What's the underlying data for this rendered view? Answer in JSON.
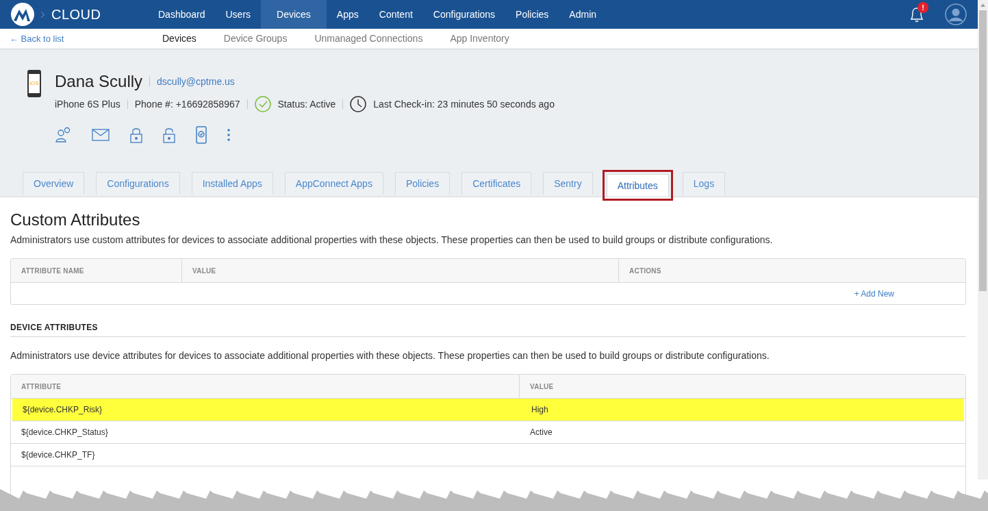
{
  "top_nav": {
    "brand": "CLOUD",
    "items": [
      {
        "label": "Dashboard",
        "selected": false
      },
      {
        "label": "Users",
        "selected": false
      },
      {
        "label": "Devices",
        "selected": true
      },
      {
        "label": "Apps",
        "selected": false
      },
      {
        "label": "Content",
        "selected": false
      },
      {
        "label": "Configurations",
        "selected": false
      },
      {
        "label": "Policies",
        "selected": false
      },
      {
        "label": "Admin",
        "selected": false
      }
    ],
    "notification_badge": "!"
  },
  "sub_nav": {
    "back_link": "← Back to list",
    "items": [
      {
        "label": "Devices",
        "selected": true
      },
      {
        "label": "Device Groups",
        "selected": false
      },
      {
        "label": "Unmanaged Connections",
        "selected": false
      },
      {
        "label": "App Inventory",
        "selected": false
      }
    ]
  },
  "device": {
    "platform_label": "iOS",
    "name": "Dana Scully",
    "email": "dscully@cptme.us",
    "model": "iPhone 6S Plus",
    "phone": "Phone #: +16692858967",
    "status": "Status: Active",
    "last_checkin": "Last Check-in: 23 minutes 50 seconds ago"
  },
  "tabs": [
    {
      "label": "Overview",
      "selected": false,
      "highlighted": false
    },
    {
      "label": "Configurations",
      "selected": false,
      "highlighted": false
    },
    {
      "label": "Installed Apps",
      "selected": false,
      "highlighted": false
    },
    {
      "label": "AppConnect Apps",
      "selected": false,
      "highlighted": false
    },
    {
      "label": "Policies",
      "selected": false,
      "highlighted": false
    },
    {
      "label": "Certificates",
      "selected": false,
      "highlighted": false
    },
    {
      "label": "Sentry",
      "selected": false,
      "highlighted": false
    },
    {
      "label": "Attributes",
      "selected": true,
      "highlighted": true
    },
    {
      "label": "Logs",
      "selected": false,
      "highlighted": false
    }
  ],
  "custom_attributes": {
    "title": "Custom Attributes",
    "description": "Administrators use custom attributes for devices to associate additional properties with these objects. These properties can then be used to build groups or distribute configurations.",
    "columns": [
      "ATTRIBUTE NAME",
      "VALUE",
      "ACTIONS"
    ],
    "add_link": "+ Add New"
  },
  "device_attributes": {
    "title": "DEVICE ATTRIBUTES",
    "description": "Administrators use device attributes for devices to associate additional properties with these objects. These properties can then be used to build groups or distribute configurations.",
    "columns": [
      "ATTRIBUTE",
      "VALUE"
    ],
    "rows": [
      {
        "attribute": "${device.CHKP_Risk}",
        "value": "High",
        "highlighted": true
      },
      {
        "attribute": "${device.CHKP_Status}",
        "value": "Active",
        "highlighted": false
      },
      {
        "attribute": "${device.CHKP_TF}",
        "highlighted": false
      }
    ]
  }
}
